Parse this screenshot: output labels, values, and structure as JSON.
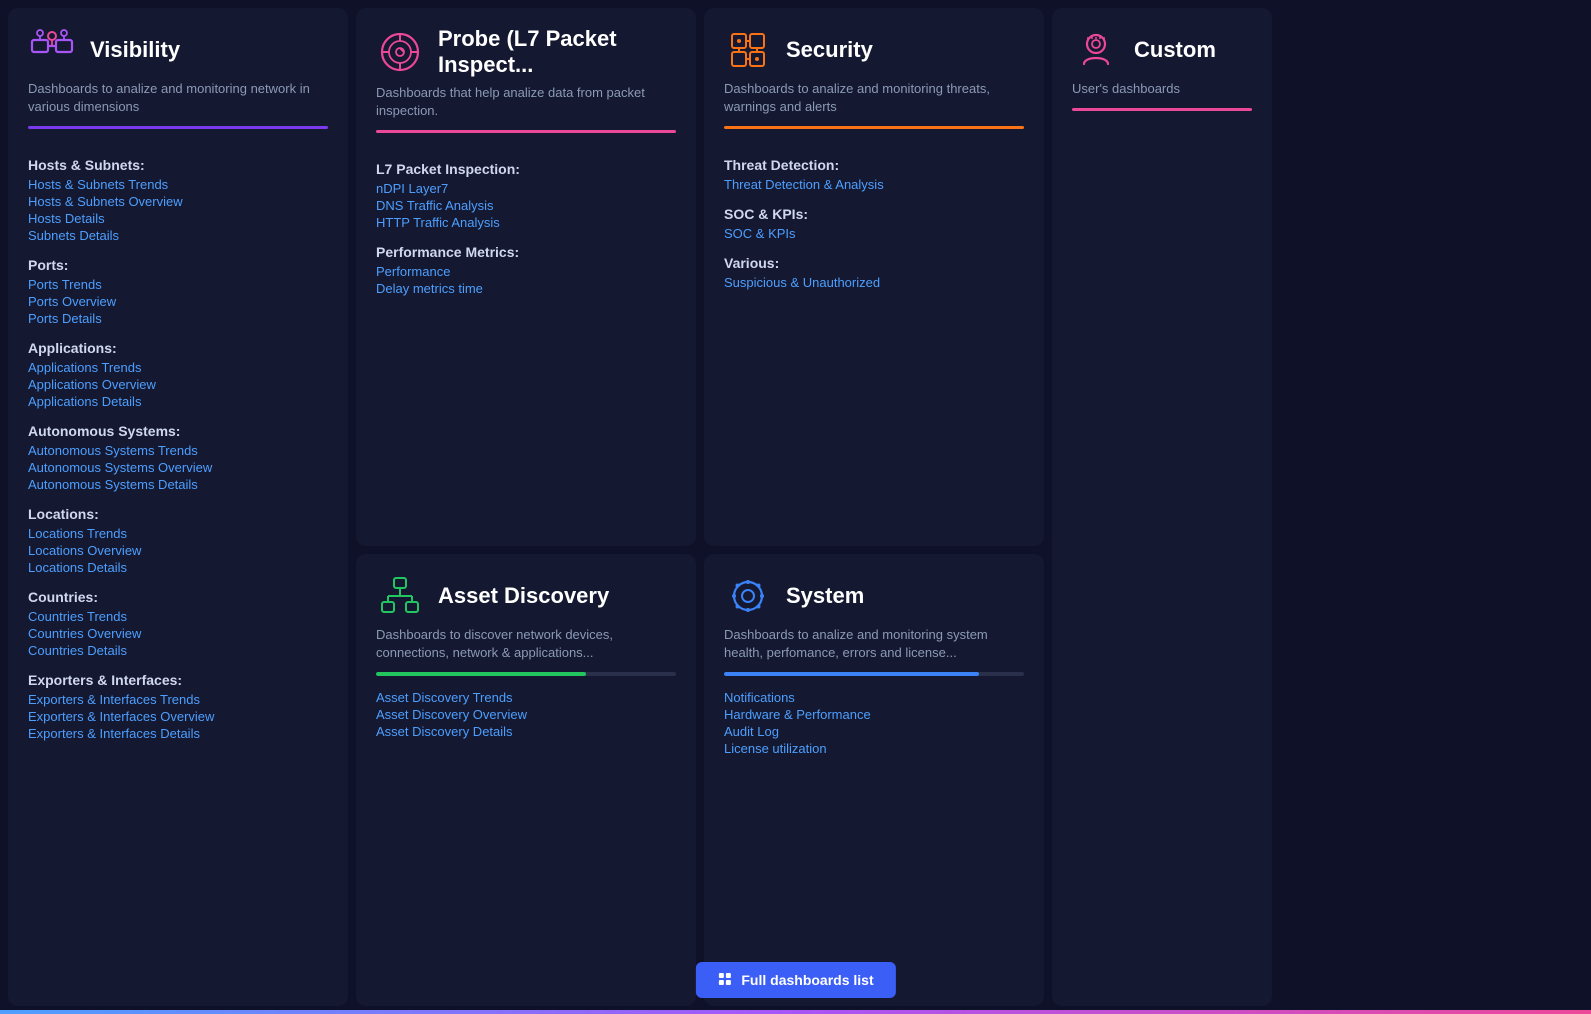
{
  "visibility": {
    "title": "Visibility",
    "subtitle": "Dashboards to analize and monitoring network in various dimensions",
    "accentColor": "#7c3aed",
    "sections": [
      {
        "label": "Hosts & Subnets:",
        "links": [
          "Hosts & Subnets Trends",
          "Hosts & Subnets Overview",
          "Hosts Details",
          "Subnets Details"
        ]
      },
      {
        "label": "Ports:",
        "links": [
          "Ports Trends",
          "Ports Overview",
          "Ports Details"
        ]
      },
      {
        "label": "Applications:",
        "links": [
          "Applications Trends",
          "Applications Overview",
          "Applications Details"
        ]
      },
      {
        "label": "Autonomous Systems:",
        "links": [
          "Autonomous Systems Trends",
          "Autonomous Systems Overview",
          "Autonomous Systems Details"
        ]
      },
      {
        "label": "Locations:",
        "links": [
          "Locations Trends",
          "Locations Overview",
          "Locations Details"
        ]
      },
      {
        "label": "Countries:",
        "links": [
          "Countries Trends",
          "Countries Overview",
          "Countries Details"
        ]
      },
      {
        "label": "Exporters & Interfaces:",
        "links": [
          "Exporters & Interfaces Trends",
          "Exporters & Interfaces Overview",
          "Exporters & Interfaces Details"
        ]
      }
    ]
  },
  "probe": {
    "title": "Probe (L7 Packet Inspect...",
    "subtitle": "Dashboards that help analize data from packet inspection.",
    "accentColor": "#ec4899",
    "sections": [
      {
        "label": "L7 Packet Inspection:",
        "links": [
          "nDPI Layer7",
          "DNS Traffic Analysis",
          "HTTP Traffic Analysis"
        ]
      },
      {
        "label": "Performance Metrics:",
        "links": [
          "Performance",
          "Delay metrics time"
        ]
      }
    ]
  },
  "security": {
    "title": "Security",
    "subtitle": "Dashboards to analize and monitoring threats, warnings and alerts",
    "accentColor": "#f97316",
    "sections": [
      {
        "label": "Threat Detection:",
        "links": [
          "Threat Detection & Analysis"
        ]
      },
      {
        "label": "SOC & KPIs:",
        "links": [
          "SOC & KPIs"
        ]
      },
      {
        "label": "Various:",
        "links": [
          "Suspicious & Unauthorized"
        ]
      }
    ]
  },
  "custom": {
    "title": "Custom",
    "subtitle": "User's dashboards",
    "accentColor": "#ec4899"
  },
  "asset": {
    "title": "Asset Discovery",
    "subtitle": "Dashboards to discover network devices, connections, network & applications...",
    "accentColor": "#22c55e",
    "progressColor": "#22c55e",
    "progressWidth": "70%",
    "links": [
      "Asset Discovery Trends",
      "Asset Discovery Overview",
      "Asset Discovery Details"
    ]
  },
  "system": {
    "title": "System",
    "subtitle": "Dashboards to analize and monitoring system health, perfomance, errors and license...",
    "accentColor": "#3b82f6",
    "progressColor": "#3b82f6",
    "progressWidth": "85%",
    "links": [
      "Notifications",
      "Hardware & Performance",
      "Audit Log",
      "License utilization"
    ]
  },
  "fullDashboards": {
    "label": "Full dashboards list"
  }
}
